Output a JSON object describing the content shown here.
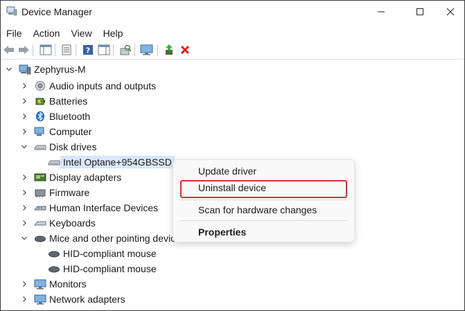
{
  "window": {
    "title": "Device Manager"
  },
  "menu": [
    "File",
    "Action",
    "View",
    "Help"
  ],
  "tree": {
    "root": "Zephyrus-M",
    "disk_device": "Intel Optane+954GBSSD",
    "items": [
      "Audio inputs and outputs",
      "Batteries",
      "Bluetooth",
      "Computer",
      "Disk drives",
      "Display adapters",
      "Firmware",
      "Human Interface Devices",
      "Keyboards",
      "Mice and other pointing devices",
      "Monitors",
      "Network adapters"
    ],
    "mice_children": [
      "HID-compliant mouse",
      "HID-compliant mouse"
    ]
  },
  "context_menu": {
    "update": "Update driver",
    "uninstall": "Uninstall device",
    "scan": "Scan for hardware changes",
    "properties": "Properties"
  },
  "colors": {
    "highlight": "#d0303a",
    "selection": "#d9e8fb"
  }
}
